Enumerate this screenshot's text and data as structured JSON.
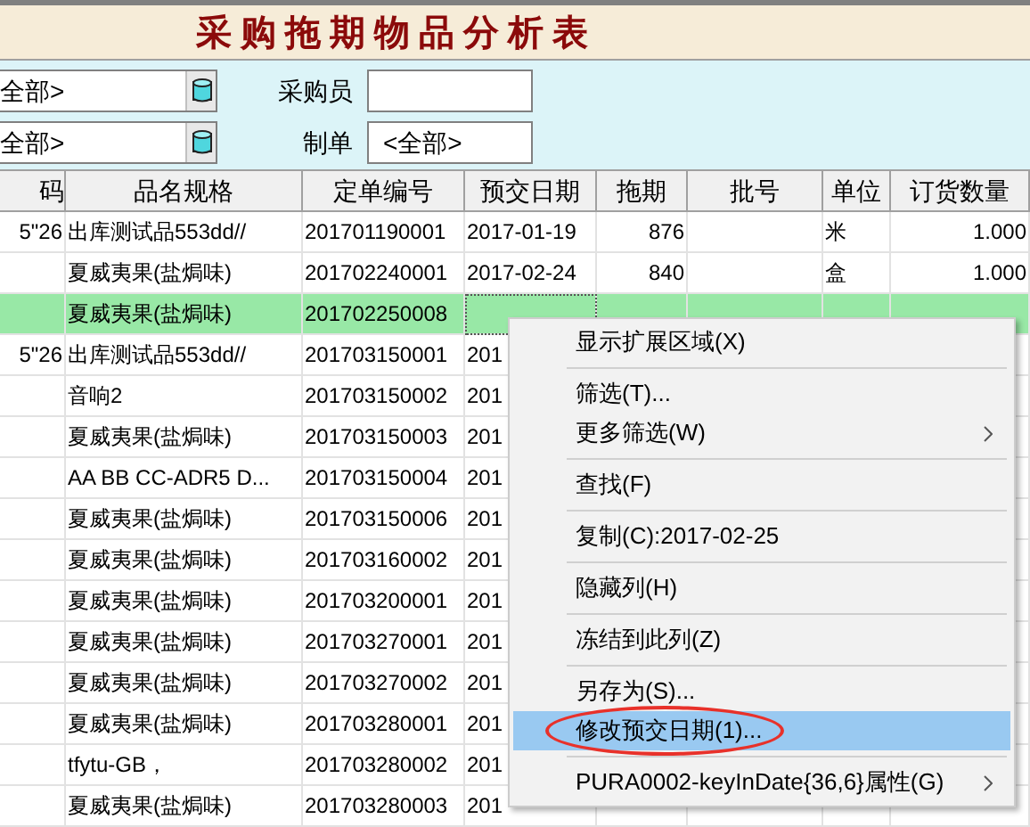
{
  "title": "采购拖期物品分析表",
  "filters": {
    "combos": [
      {
        "value": "全部>"
      },
      {
        "value": "全部>"
      }
    ],
    "fields": [
      {
        "label": "采购员"
      },
      {
        "label": "制单",
        "value": "<全部>"
      }
    ]
  },
  "table": {
    "columns": [
      "码",
      "品名规格",
      "定单编号",
      "预交日期",
      "拖期",
      "批号",
      "单位",
      "订货数量"
    ],
    "rows": [
      {
        "selected": false,
        "cells": [
          "5\"26",
          "出库测试品553dd//",
          "201701190001",
          "2017-01-19",
          "876",
          null,
          "米",
          "1.000"
        ]
      },
      {
        "selected": false,
        "cells": [
          null,
          "夏威夷果(盐焗味)",
          "201702240001",
          "2017-02-24",
          "840",
          null,
          "盒",
          "1.000"
        ]
      },
      {
        "selected": true,
        "cells": [
          null,
          "夏威夷果(盐焗味)",
          "201702250008",
          null,
          null,
          null,
          null,
          null
        ]
      },
      {
        "selected": false,
        "cells": [
          "5\"26",
          "出库测试品553dd//",
          "201703150001",
          "201",
          null,
          null,
          null,
          null
        ]
      },
      {
        "selected": false,
        "cells": [
          null,
          "音响2",
          "201703150002",
          "201",
          null,
          null,
          null,
          null
        ]
      },
      {
        "selected": false,
        "cells": [
          null,
          "夏威夷果(盐焗味)",
          "201703150003",
          "201",
          null,
          null,
          null,
          null
        ]
      },
      {
        "selected": false,
        "cells": [
          null,
          "AA BB CC-ADR5 D...",
          "201703150004",
          "201",
          null,
          null,
          null,
          null
        ]
      },
      {
        "selected": false,
        "cells": [
          null,
          "夏威夷果(盐焗味)",
          "201703150006",
          "201",
          null,
          null,
          null,
          null
        ]
      },
      {
        "selected": false,
        "cells": [
          null,
          "夏威夷果(盐焗味)",
          "201703160002",
          "201",
          null,
          null,
          null,
          null
        ]
      },
      {
        "selected": false,
        "cells": [
          null,
          "夏威夷果(盐焗味)",
          "201703200001",
          "201",
          null,
          null,
          null,
          null
        ]
      },
      {
        "selected": false,
        "cells": [
          null,
          "夏威夷果(盐焗味)",
          "201703270001",
          "201",
          null,
          null,
          null,
          null
        ]
      },
      {
        "selected": false,
        "cells": [
          null,
          "夏威夷果(盐焗味)",
          "201703270002",
          "201",
          null,
          null,
          null,
          null
        ]
      },
      {
        "selected": false,
        "cells": [
          null,
          "夏威夷果(盐焗味)",
          "201703280001",
          "201",
          null,
          null,
          null,
          null
        ]
      },
      {
        "selected": false,
        "cells": [
          null,
          "tfytu-GB，",
          "201703280002",
          "201",
          null,
          null,
          null,
          null
        ]
      },
      {
        "selected": false,
        "cells": [
          null,
          "夏威夷果(盐焗味)",
          "201703280003",
          "201",
          null,
          null,
          null,
          null
        ]
      }
    ]
  },
  "context_menu": {
    "groups": [
      [
        {
          "label": "显示扩展区域(X)",
          "submenu": false,
          "selected": false,
          "circled": false
        }
      ],
      [
        {
          "label": "筛选(T)...",
          "submenu": false,
          "selected": false,
          "circled": false
        },
        {
          "label": "更多筛选(W)",
          "submenu": true,
          "selected": false,
          "circled": false
        }
      ],
      [
        {
          "label": "查找(F)",
          "submenu": false,
          "selected": false,
          "circled": false
        }
      ],
      [
        {
          "label": "复制(C):2017-02-25",
          "submenu": false,
          "selected": false,
          "circled": false
        }
      ],
      [
        {
          "label": "隐藏列(H)",
          "submenu": false,
          "selected": false,
          "circled": false
        }
      ],
      [
        {
          "label": "冻结到此列(Z)",
          "submenu": false,
          "selected": false,
          "circled": false
        }
      ],
      [
        {
          "label": "另存为(S)...",
          "submenu": false,
          "selected": false,
          "circled": false
        },
        {
          "label": "修改预交日期(1)...",
          "submenu": false,
          "selected": true,
          "circled": true
        }
      ],
      [
        {
          "label": "PURA0002-keyInDate{36,6}属性(G)",
          "submenu": true,
          "selected": false,
          "circled": false
        }
      ]
    ]
  }
}
